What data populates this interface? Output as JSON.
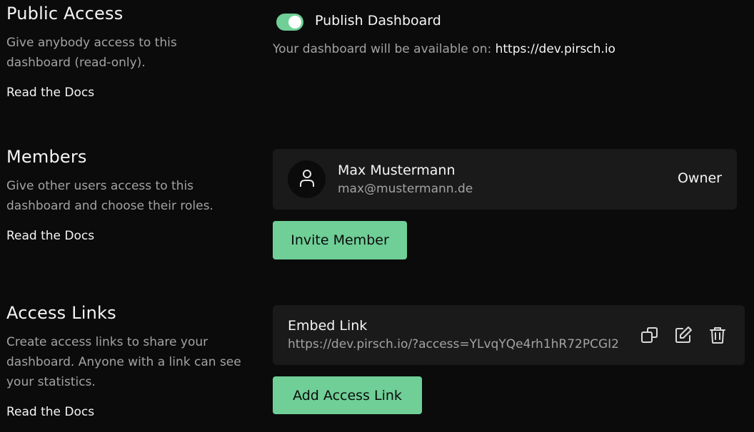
{
  "public_access": {
    "title": "Public Access",
    "description": "Give anybody access to this dashboard (read-only).",
    "docs_link": "Read the Docs",
    "toggle_label": "Publish Dashboard",
    "toggle_on": true,
    "availability_text": "Your dashboard will be available on: ",
    "availability_url": "https://dev.pirsch.io"
  },
  "members": {
    "title": "Members",
    "description": "Give other users access to this dashboard and choose their roles.",
    "docs_link": "Read the Docs",
    "list": [
      {
        "name": "Max Mustermann",
        "email": "max@mustermann.de",
        "role": "Owner",
        "icon": "user-icon"
      }
    ],
    "invite_button": "Invite Member"
  },
  "access_links": {
    "title": "Access Links",
    "description": "Create access links to share your dashboard. Anyone with a link can see your statistics.",
    "docs_link": "Read the Docs",
    "list": [
      {
        "name": "Embed Link",
        "url": "https://dev.pirsch.io/?access=YLvqYQe4rh1hR72PCGI2",
        "icons": [
          "copy-icon",
          "edit-icon",
          "trash-icon"
        ]
      }
    ],
    "add_button": "Add Access Link"
  },
  "colors": {
    "background": "#0b0b0b",
    "card": "#1a1a1a",
    "accent": "#6fcf97",
    "muted_text": "#a3a3a3"
  }
}
